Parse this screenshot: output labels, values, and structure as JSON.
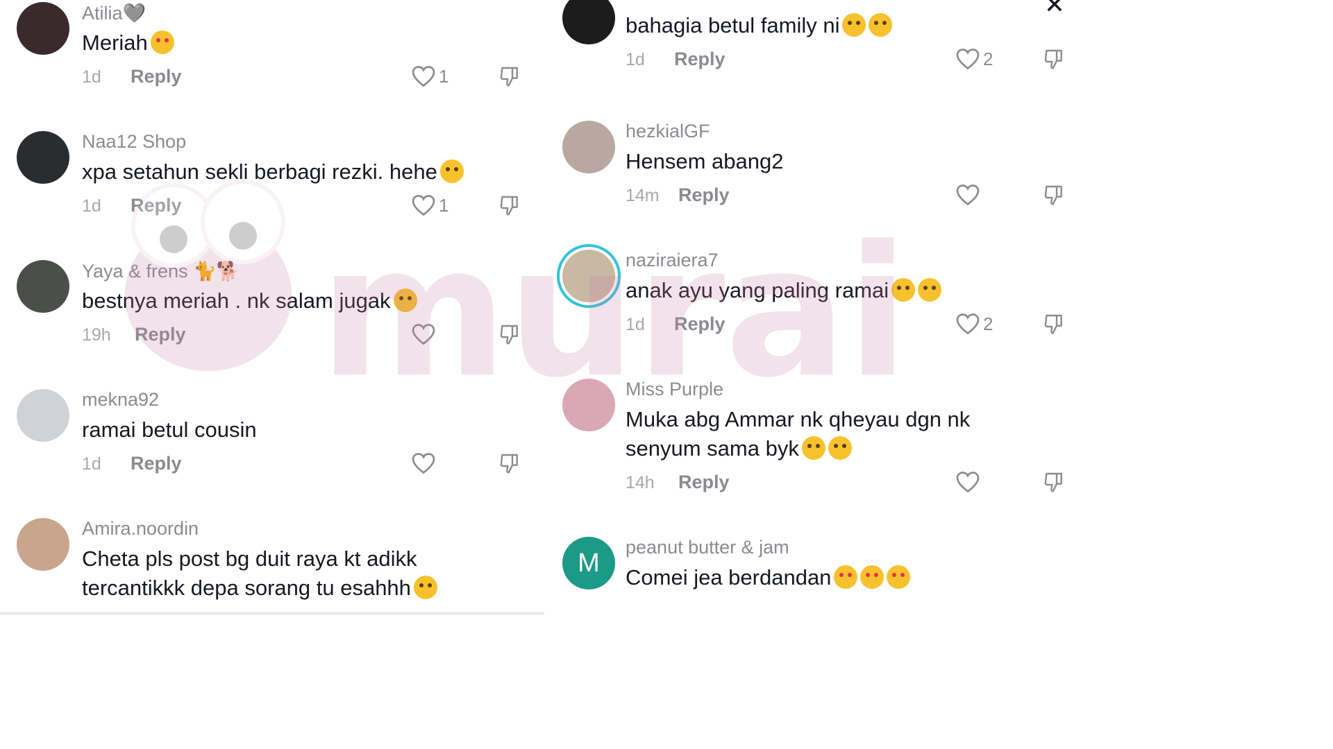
{
  "left": {
    "comments": [
      {
        "username": "Atilia🩶",
        "text": "Meriah",
        "emoji": "smiling-face-with-hearts",
        "time": "1d",
        "reply": "Reply",
        "likes": "1",
        "avatar_color": "#3a2a2e"
      },
      {
        "username": "Naa12 Shop",
        "text": "xpa setahun sekli berbagi rezki. hehe",
        "emoji": "grimacing-face",
        "time": "1d",
        "reply": "Reply",
        "likes": "1",
        "avatar_color": "#2a2d30"
      },
      {
        "username": "Yaya & frens 🐈🐕",
        "text": "bestnya meriah . nk salam jugak",
        "emoji": "rolling-laughing-face",
        "time": "19h",
        "reply": "Reply",
        "likes": "",
        "avatar_color": "#4b4f4a"
      },
      {
        "username": "mekna92",
        "text": "ramai betul cousin",
        "emoji": "",
        "time": "1d",
        "reply": "Reply",
        "likes": "",
        "avatar_color": "#cfd3d8"
      },
      {
        "username": "Amira.noordin",
        "text": "Cheta pls post bg duit raya kt adikk tercantikkk depa sorang tu esahhh",
        "emoji": "tears-of-joy-face",
        "time": "",
        "reply": "",
        "likes": "",
        "avatar_color": "#c9a58d"
      }
    ]
  },
  "right": {
    "comments": [
      {
        "username": "",
        "text": "bahagia betul family ni",
        "emoji": "pleading-face pleading-face",
        "time": "1d",
        "reply": "Reply",
        "likes": "2",
        "avatar_color": "#1c1c1c"
      },
      {
        "username": "hezkialGF",
        "text": "Hensem abang2",
        "emoji": "",
        "time": "14m",
        "reply": "Reply",
        "likes": "",
        "avatar_color": "#b9a8a0"
      },
      {
        "username": "naziraiera7",
        "text": "anak ayu yang paling ramai",
        "emoji": "smiling-face smiling-face",
        "time": "1d",
        "reply": "Reply",
        "likes": "2",
        "avatar_color": "#c7b9a4"
      },
      {
        "username": "Miss Purple",
        "text": "Muka abg Ammar nk qheyau dgn nk senyum sama byk",
        "emoji": "rolling-laughing-face rolling-laughing-face",
        "time": "14h",
        "reply": "Reply",
        "likes": "",
        "avatar_color": "#d9a7b5"
      },
      {
        "username": "peanut butter & jam",
        "text": "Comei jea berdandan",
        "emoji": "heart-eyes-face heart-eyes-face heart-eyes-face",
        "time": "",
        "reply": "",
        "likes": "",
        "avatar_color": "#1b9a88",
        "avatar_letter": "M"
      }
    ]
  },
  "watermark": {
    "text": "murai"
  },
  "close": {
    "icon": "close-icon"
  }
}
